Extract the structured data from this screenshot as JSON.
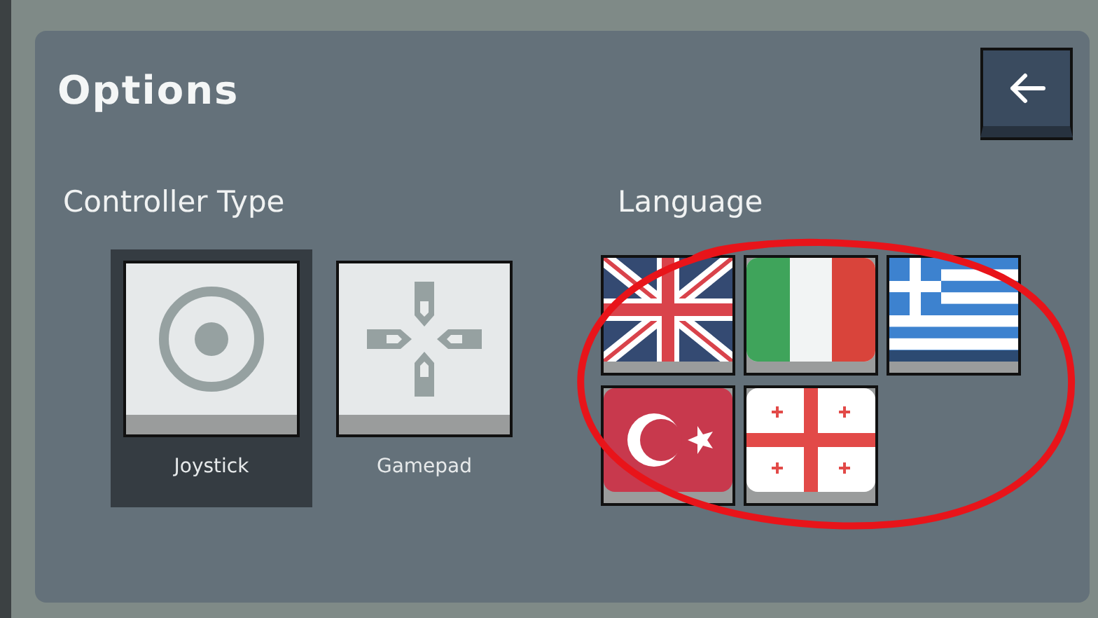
{
  "title": "Options",
  "controller_type": {
    "heading": "Controller Type",
    "options": [
      {
        "kind": "joystick",
        "label": "Joystick",
        "selected": true
      },
      {
        "kind": "gamepad",
        "label": "Gamepad",
        "selected": false
      }
    ]
  },
  "language": {
    "heading": "Language",
    "flags": [
      {
        "kind": "uk"
      },
      {
        "kind": "italy"
      },
      {
        "kind": "greece"
      },
      {
        "kind": "turkey"
      },
      {
        "kind": "georgia"
      }
    ]
  },
  "annotation": {
    "kind": "ellipse"
  }
}
